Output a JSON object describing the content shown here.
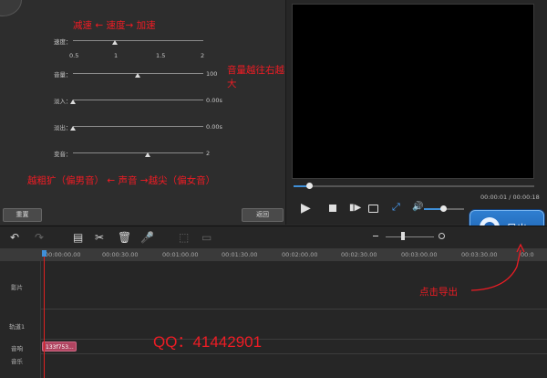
{
  "settings": {
    "sliders": [
      {
        "label": "速度：",
        "value": "",
        "ticks": [
          "0.5",
          "1",
          "1.5",
          "2"
        ]
      },
      {
        "label": "音量：",
        "value": "100"
      },
      {
        "label": "淡入：",
        "value": "0.00s"
      },
      {
        "label": "淡出：",
        "value": "0.00s"
      },
      {
        "label": "变音：",
        "value": "2"
      }
    ],
    "reset_label": "重置",
    "back_label": "返回"
  },
  "annotations": {
    "speed_note": "减速 ←  速度→    加速",
    "volume_note": "音量越往右越大",
    "pitch_note": "越粗犷（偏男音） ←  声音  →越尖（偏女音）",
    "export_note": "点击导出",
    "qq": "QQ：41442901"
  },
  "preview": {
    "time": "00:00:01 / 00:00:18"
  },
  "export": {
    "label": "导出"
  },
  "ruler": {
    "ticks": [
      "00:00:00.00",
      "00:00:30.00",
      "00:01:00.00",
      "00:01:30.00",
      "00:02:00.00",
      "00:02:30.00",
      "00:03:00.00",
      "00:03:30.00",
      "00:0"
    ]
  },
  "tracks": {
    "labels": [
      "影片",
      "轨道1",
      "音响",
      "音乐"
    ],
    "clip_label": "133f753..."
  },
  "colors": {
    "accent": "#2f7fd1",
    "annotation": "#ee1c24",
    "playhead": "#e02020"
  }
}
